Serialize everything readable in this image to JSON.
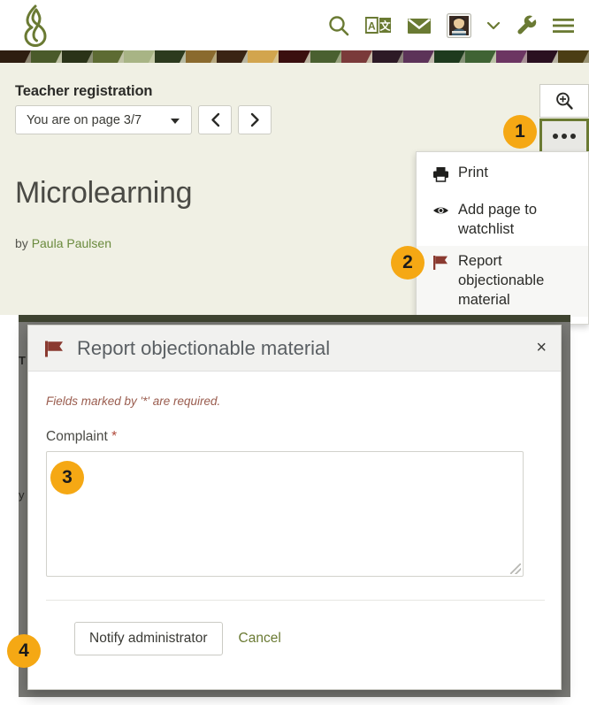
{
  "header": {
    "logo_name": "mahara-logo",
    "icons": [
      {
        "name": "search-icon",
        "label": "Search"
      },
      {
        "name": "translate-icon",
        "label": "Change language"
      },
      {
        "name": "inbox-icon",
        "label": "Inbox"
      },
      {
        "name": "avatar-icon",
        "label": "User menu"
      },
      {
        "name": "chevron-down-icon",
        "label": "Expand user menu"
      },
      {
        "name": "wrench-icon",
        "label": "Administration"
      },
      {
        "name": "hamburger-icon",
        "label": "Main menu"
      }
    ]
  },
  "banner": {
    "colors": [
      "#2e1d10",
      "#4a5a2a",
      "#2a3318",
      "#5d6b33",
      "#a8b485",
      "#2c3a1e",
      "#8a6a2e",
      "#3a2414",
      "#d2a54e",
      "#3a0f0f",
      "#4a6030",
      "#7a3a3a",
      "#2d1a26",
      "#5c3359",
      "#1e3a1e",
      "#3f6334",
      "#6c3562",
      "#2a1020",
      "#4b3d14"
    ],
    "triangle_color": "#d8d8c0"
  },
  "page": {
    "section_title": "Teacher registration",
    "page_selector_value": "You are on page 3/7",
    "prev_label": "Previous page",
    "next_label": "Next page",
    "title": "Microlearning",
    "byline_prefix": "by",
    "byline_author": "Paula Paulsen"
  },
  "tools": {
    "zoom_button_label": "Zoom in",
    "more_button_label": "More options"
  },
  "menu": {
    "items": [
      {
        "label": "Print",
        "icon": "printer-icon"
      },
      {
        "label": "Add page to watchlist",
        "icon": "eye-icon"
      },
      {
        "label": "Report objectionable material",
        "icon": "flag-icon"
      }
    ]
  },
  "modal": {
    "title": "Report objectionable material",
    "title_icon": "flag-icon",
    "close_label": "×",
    "required_note": "Fields marked by '*' are required.",
    "field_label": "Complaint",
    "required_marker": "*",
    "complaint_value": "",
    "complaint_placeholder": "",
    "submit_label": "Notify administrator",
    "cancel_label": "Cancel"
  },
  "callouts": {
    "one": "1",
    "two": "2",
    "three": "3",
    "four": "4"
  },
  "colors": {
    "accent_green": "#6a7a33",
    "callout_orange": "#f5a814",
    "flag_red": "#8a3a30",
    "content_bg": "#f0f0e4"
  }
}
